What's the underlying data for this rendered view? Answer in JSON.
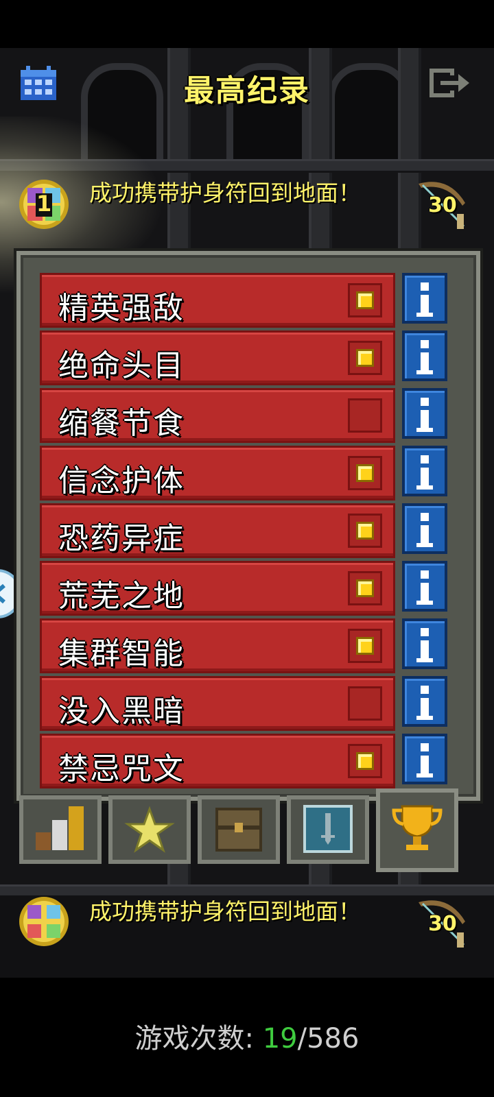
{
  "header": {
    "title": "最高纪录",
    "calendar_icon": "calendar-icon",
    "exit_icon": "exit-icon"
  },
  "records": [
    {
      "rank": "1",
      "text": "成功携带护身符回到地面！",
      "level": "30",
      "weapon_icon": "bow-icon"
    },
    {
      "rank": "",
      "text": "成功携带护身符回到地面！",
      "level": "30",
      "weapon_icon": "bow-icon"
    }
  ],
  "challenges": [
    {
      "label": "精英强敌",
      "enabled": true
    },
    {
      "label": "绝命头目",
      "enabled": true
    },
    {
      "label": "缩餐节食",
      "enabled": false
    },
    {
      "label": "信念护体",
      "enabled": true
    },
    {
      "label": "恐药异症",
      "enabled": true
    },
    {
      "label": "荒芜之地",
      "enabled": true
    },
    {
      "label": "集群智能",
      "enabled": true
    },
    {
      "label": "没入黑暗",
      "enabled": false
    },
    {
      "label": "禁忌咒文",
      "enabled": true
    }
  ],
  "tabs": [
    {
      "icon": "stats-bars-icon",
      "active": false
    },
    {
      "icon": "star-icon",
      "active": false
    },
    {
      "icon": "chest-icon",
      "active": false
    },
    {
      "icon": "tombstone-icon",
      "active": false
    },
    {
      "icon": "trophy-icon",
      "active": true
    }
  ],
  "footer": {
    "games_label": "游戏次数:",
    "games_won": "19",
    "separator": "/",
    "games_total": "586"
  },
  "colors": {
    "title": "#fff36a",
    "challenge_bg": "#b82b2a",
    "info_bg": "#1d5fb3",
    "checkbox_on": "#ffd21a",
    "games_won": "#3fcc3f"
  }
}
